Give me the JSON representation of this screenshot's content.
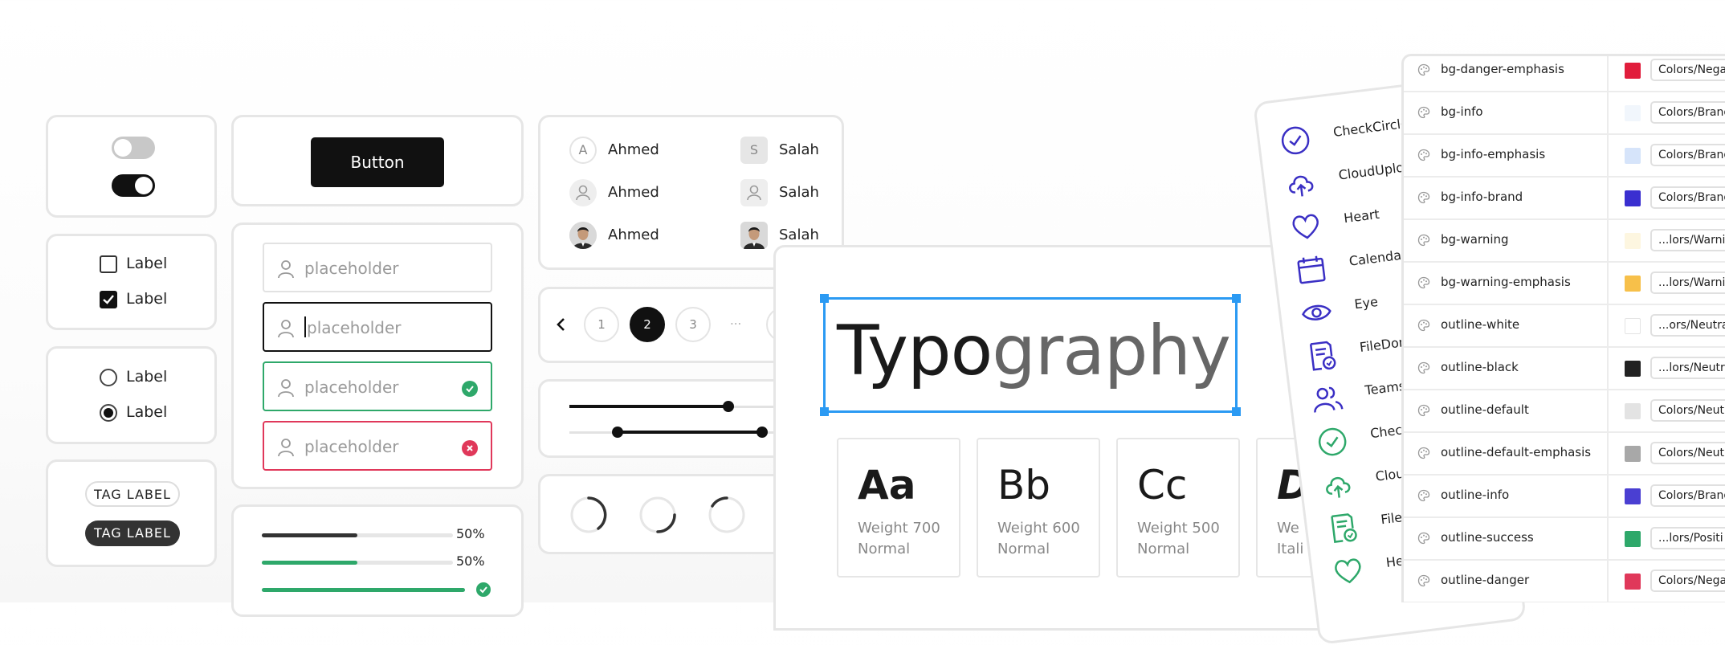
{
  "toggles": [
    {
      "state": "off"
    },
    {
      "state": "on"
    }
  ],
  "checkboxes": [
    {
      "label": "Label",
      "checked": false
    },
    {
      "label": "Label",
      "checked": true
    }
  ],
  "radios": [
    {
      "label": "Label",
      "selected": false
    },
    {
      "label": "Label",
      "selected": true
    }
  ],
  "tags": [
    {
      "label": "TAG LABEL",
      "style": "outline"
    },
    {
      "label": "TAG LABEL",
      "style": "solid"
    }
  ],
  "button": {
    "label": "Button"
  },
  "inputs": [
    {
      "placeholder": "placeholder",
      "state": "default"
    },
    {
      "placeholder": "placeholder",
      "state": "focused"
    },
    {
      "placeholder": "placeholder",
      "state": "success"
    },
    {
      "placeholder": "placeholder",
      "state": "error"
    }
  ],
  "progress": [
    {
      "value": 0.5,
      "label": "50%",
      "color": "#333333"
    },
    {
      "value": 0.5,
      "label": "50%",
      "color": "#2ea86a"
    },
    {
      "value": 1.0,
      "label": "",
      "color": "#2ea86a"
    }
  ],
  "avatars": {
    "left": [
      {
        "name": "Ahmed",
        "initial": "A",
        "type": "initial"
      },
      {
        "name": "Ahmed",
        "type": "icon"
      },
      {
        "name": "Ahmed",
        "type": "photo"
      }
    ],
    "right": [
      {
        "name": "Salah",
        "initial": "S",
        "type": "initial"
      },
      {
        "name": "Salah",
        "type": "icon"
      },
      {
        "name": "Salah",
        "type": "photo"
      }
    ]
  },
  "pagination": {
    "pages": [
      "1",
      "2",
      "3",
      "..."
    ],
    "current": "2"
  },
  "sliders": [
    {
      "value": 0.6
    },
    {
      "range": [
        0.2,
        0.8
      ]
    }
  ],
  "typography": {
    "word_dark": "Typo",
    "word_light": "graphy",
    "cards": [
      {
        "glyph": "Aa",
        "weight": "Weight 700",
        "style": "Normal"
      },
      {
        "glyph": "Bb",
        "weight": "Weight 600",
        "style": "Normal"
      },
      {
        "glyph": "Cc",
        "weight": "Weight 500",
        "style": "Normal"
      },
      {
        "glyph": "D",
        "weight": "We",
        "style": "Itali"
      }
    ]
  },
  "icons": [
    {
      "name": "CheckCircle",
      "icon": "check-circle-icon"
    },
    {
      "name": "CloudUpload",
      "icon": "cloud-upload-icon"
    },
    {
      "name": "Heart",
      "icon": "heart-icon"
    },
    {
      "name": "Calendar",
      "icon": "calendar-icon"
    },
    {
      "name": "Eye",
      "icon": "eye-icon"
    },
    {
      "name": "FileDone",
      "icon": "file-done-icon"
    },
    {
      "name": "Teams",
      "icon": "teams-icon"
    },
    {
      "name": "Check",
      "icon": "check-circle-icon"
    },
    {
      "name": "Clou",
      "icon": "cloud-upload-icon"
    },
    {
      "name": "FileD",
      "icon": "file-done-icon"
    },
    {
      "name": "Hea",
      "icon": "heart-icon"
    }
  ],
  "tokens": [
    {
      "name": "bg-danger-emphasis",
      "ref": "Colors/Negat",
      "color": "#e11d3c"
    },
    {
      "name": "bg-info",
      "ref": "Colors/Brand",
      "color": "#f1f6fc"
    },
    {
      "name": "bg-info-emphasis",
      "ref": "Colors/Brand",
      "color": "#d6e4fa"
    },
    {
      "name": "bg-info-brand",
      "ref": "Colors/Brand",
      "color": "#3a2fd0"
    },
    {
      "name": "bg-warning",
      "ref": "...lors/Warnin",
      "color": "#fdf6e0"
    },
    {
      "name": "bg-warning-emphasis",
      "ref": "...lors/Warnin",
      "color": "#f7c04a"
    },
    {
      "name": "outline-white",
      "ref": "...ors/Neutra",
      "color": "#ffffff"
    },
    {
      "name": "outline-black",
      "ref": "...lors/Neutra",
      "color": "#222222"
    },
    {
      "name": "outline-default",
      "ref": "Colors/Neutr",
      "color": "#e3e3e3"
    },
    {
      "name": "outline-default-emphasis",
      "ref": "Colors/Neutr",
      "color": "#a8a8a8"
    },
    {
      "name": "outline-info",
      "ref": "Colors/Brand",
      "color": "#4a3fd2"
    },
    {
      "name": "outline-success",
      "ref": "...lors/Positi",
      "color": "#2ea86a"
    },
    {
      "name": "outline-danger",
      "ref": "Colors/Negat",
      "color": "#e0385a"
    }
  ],
  "colors": {
    "accent": "#2b9af3",
    "icon": "#3a2fc4",
    "success": "#2ea86a",
    "danger": "#e0385a"
  }
}
